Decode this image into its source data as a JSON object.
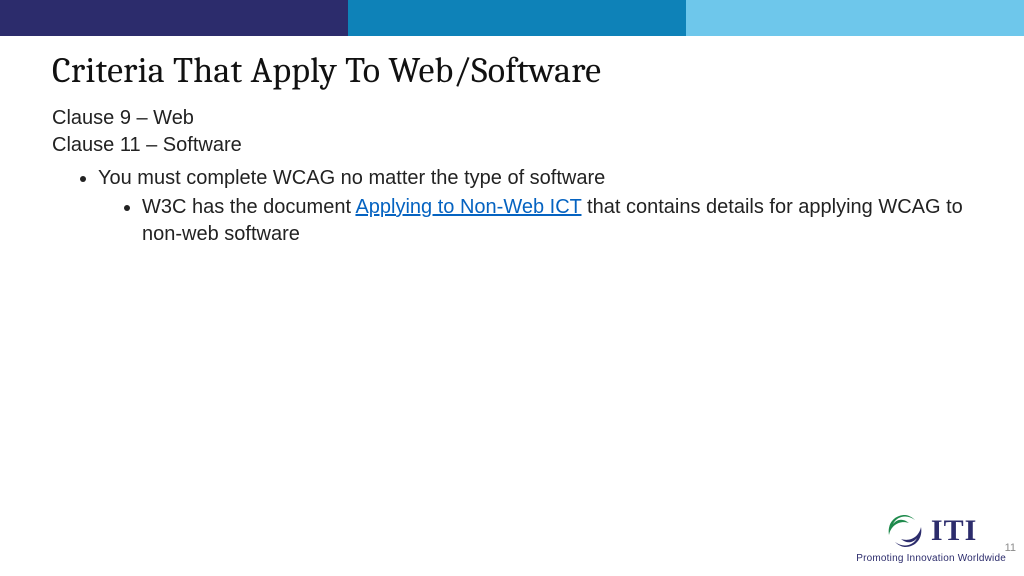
{
  "header": {
    "colors": {
      "seg1": "#2c2c6c",
      "seg2": "#0e82b8",
      "seg3": "#6ec7eb"
    }
  },
  "title": "Criteria That Apply To Web/Software",
  "clauses": [
    "Clause 9 – Web",
    "Clause 11 – Software"
  ],
  "bullets": {
    "level1_item": "You must complete WCAG no matter the type of software",
    "level2_prefix": "W3C has the document ",
    "level2_link_text": "Applying to Non-Web ICT",
    "level2_suffix": " that contains details for applying WCAG to non-web software"
  },
  "footer": {
    "logo_text": "ITI",
    "tagline": "Promoting Innovation Worldwide",
    "page_number": "11"
  }
}
